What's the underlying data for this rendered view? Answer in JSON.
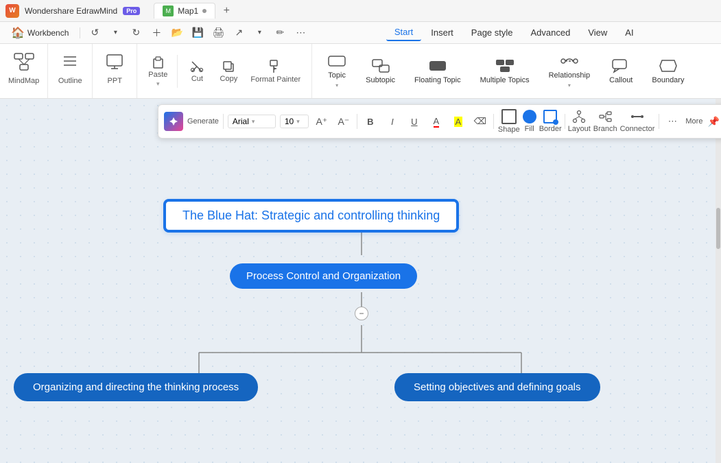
{
  "app": {
    "name": "Wondershare EdrawMind",
    "badge": "Pro",
    "tab": {
      "icon": "M",
      "name": "Map1",
      "dot": true
    }
  },
  "menubar": {
    "workbench": "Workbench",
    "menus": [
      "Start",
      "Insert",
      "Page style",
      "Advanced",
      "View",
      "AI"
    ],
    "active_menu": "Start"
  },
  "ribbon": {
    "left_tools": [
      {
        "id": "mindmap",
        "label": "MindMap",
        "icon": "⊞"
      },
      {
        "id": "outline",
        "label": "Outline",
        "icon": "≡"
      },
      {
        "id": "ppt",
        "label": "PPT",
        "icon": "▣"
      }
    ],
    "edit_tools": [
      {
        "id": "paste",
        "label": "Paste",
        "icon": "📋"
      },
      {
        "id": "cut",
        "label": "Cut",
        "icon": "✂"
      },
      {
        "id": "copy",
        "label": "Copy",
        "icon": "⧉"
      },
      {
        "id": "format-painter",
        "label": "Format Painter",
        "icon": "🖌"
      }
    ],
    "insert_tools": [
      {
        "id": "topic",
        "label": "Topic",
        "icon": "⬜"
      },
      {
        "id": "subtopic",
        "label": "Subtopic",
        "icon": "⬜⬜"
      },
      {
        "id": "floating-topic",
        "label": "Floating Topic",
        "icon": "⬛"
      },
      {
        "id": "multiple-topics",
        "label": "Multiple Topics",
        "icon": "⬛⬛"
      },
      {
        "id": "relationship",
        "label": "Relationship",
        "icon": "↔"
      },
      {
        "id": "callout",
        "label": "Callout",
        "icon": "💬"
      },
      {
        "id": "boundary",
        "label": "Boundary",
        "icon": "⬡"
      }
    ]
  },
  "floating_toolbar": {
    "generate_label": "Generate",
    "font": "Arial",
    "font_size": "10",
    "bold": "B",
    "italic": "I",
    "underline": "U",
    "font_color": "A",
    "highlight": "A",
    "eraser": "⌫",
    "shape_label": "Shape",
    "fill_label": "Fill",
    "border_label": "Border",
    "layout_label": "Layout",
    "branch_label": "Branch",
    "connector_label": "Connector",
    "more_label": "More"
  },
  "canvas": {
    "main_node": "The Blue Hat: Strategic and controlling thinking",
    "child_node_1": "Process Control and Organization",
    "bottom_node_1": "Organizing and directing the thinking process",
    "bottom_node_2": "Setting objectives and defining goals"
  }
}
